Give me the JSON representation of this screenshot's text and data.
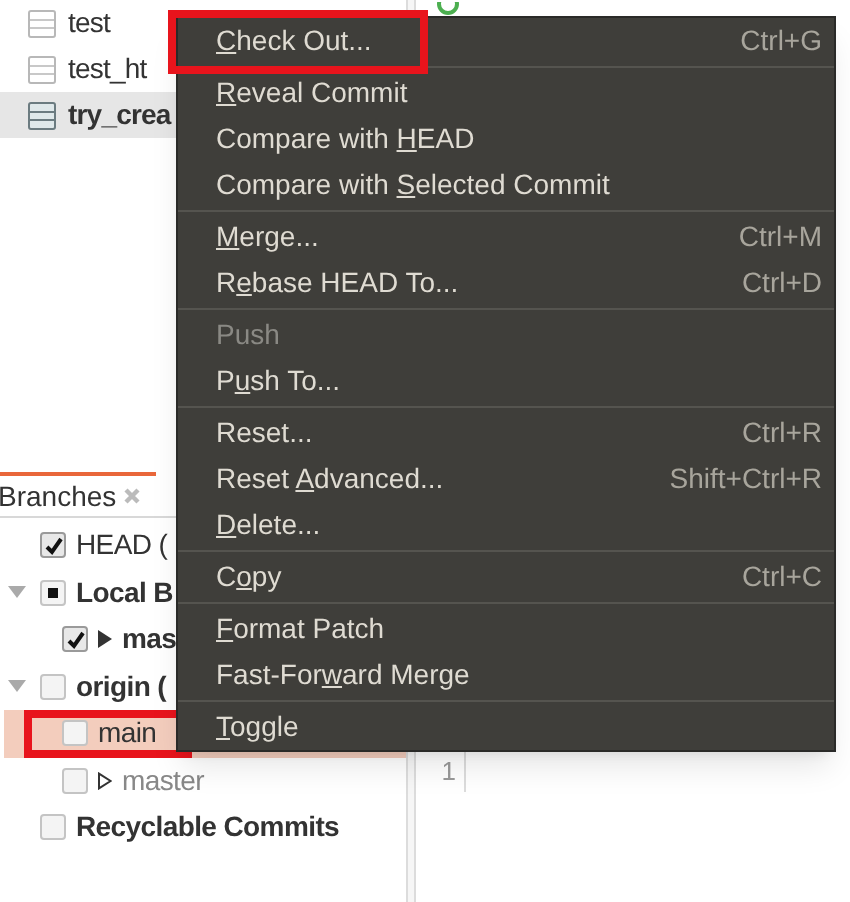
{
  "repositories": [
    {
      "label": "test",
      "selected": false
    },
    {
      "label": "test_ht",
      "selected": false
    },
    {
      "label": "try_crea",
      "selected": true
    }
  ],
  "branches_view": {
    "tab": {
      "label": "Branches",
      "selected": true
    },
    "tree": [
      {
        "kind": "ref",
        "label": "HEAD (",
        "checked": true,
        "bold": false,
        "selected": false
      },
      {
        "kind": "folder",
        "label": "Local B",
        "mixed": true,
        "expanded": true,
        "bold": true,
        "selected": false,
        "children": [
          {
            "kind": "local",
            "label": "mas",
            "checked": true,
            "bold": true,
            "selected": false
          }
        ]
      },
      {
        "kind": "folder",
        "label": "origin (",
        "checked": false,
        "expanded": true,
        "bold": true,
        "selected": false,
        "children": [
          {
            "kind": "ref",
            "label": "main",
            "checked": false,
            "bold": false,
            "selected": true,
            "annotated": true
          },
          {
            "kind": "remote",
            "label": "master",
            "checked": false,
            "bold": false,
            "selected": false,
            "dimmed": true
          }
        ]
      },
      {
        "kind": "ref",
        "label": "Recyclable Commits",
        "checked": false,
        "bold": true,
        "selected": false
      }
    ]
  },
  "editor": {
    "line_numbers": [
      "1"
    ]
  },
  "context_menu": {
    "groups": [
      [
        {
          "mnemonic": "C",
          "label_end": "heck Out...",
          "shortcut": "Ctrl+G",
          "disabled": false,
          "annotated": true
        }
      ],
      [
        {
          "mnemonic": "R",
          "label_end": "eveal Commit",
          "disabled": false
        },
        {
          "label_start": "Compare with ",
          "mnemonic": "H",
          "label_end": "EAD",
          "disabled": false
        },
        {
          "label_start": "Compare with ",
          "mnemonic": "S",
          "label_end": "elected Commit",
          "disabled": false
        }
      ],
      [
        {
          "mnemonic": "M",
          "label_end": "erge...",
          "shortcut": "Ctrl+M",
          "disabled": false
        },
        {
          "label_start": "R",
          "mnemonic": "e",
          "label_end": "base HEAD To...",
          "shortcut": "Ctrl+D",
          "disabled": false
        }
      ],
      [
        {
          "label_start": "Push",
          "disabled": true
        },
        {
          "label_start": "P",
          "mnemonic": "u",
          "label_end": "sh To...",
          "disabled": false
        }
      ],
      [
        {
          "label_start": "Reset...",
          "shortcut": "Ctrl+R",
          "disabled": false
        },
        {
          "label_start": "Reset ",
          "mnemonic": "A",
          "label_end": "dvanced...",
          "shortcut": "Shift+Ctrl+R",
          "disabled": false
        },
        {
          "mnemonic": "D",
          "label_end": "elete...",
          "disabled": false
        }
      ],
      [
        {
          "label_start": "C",
          "mnemonic": "o",
          "label_end": "py",
          "shortcut": "Ctrl+C",
          "disabled": false
        }
      ],
      [
        {
          "mnemonic": "F",
          "label_end": "ormat Patch",
          "disabled": false
        },
        {
          "label_start": "Fast-For",
          "mnemonic": "w",
          "label_end": "ard Merge",
          "disabled": false
        }
      ],
      [
        {
          "mnemonic": "T",
          "label_end": "oggle",
          "disabled": false
        }
      ]
    ]
  }
}
